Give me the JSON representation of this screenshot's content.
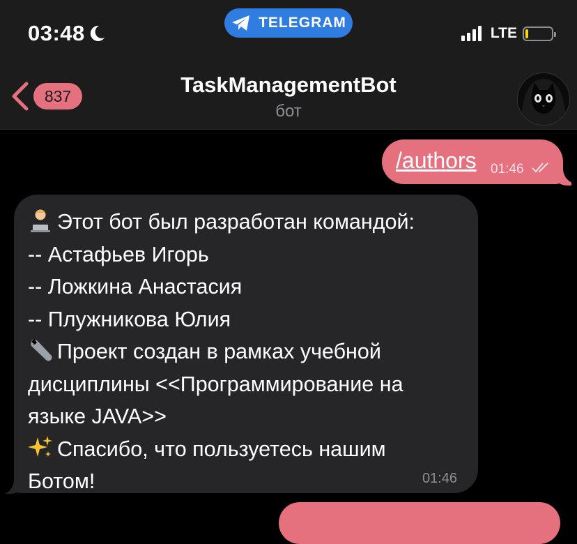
{
  "status_bar": {
    "time": "03:48",
    "return_pill_label": "TELEGRAM",
    "network": "LTE",
    "battery_level": 0.1
  },
  "header": {
    "unread_count": "837",
    "title": "TaskManagementBot",
    "subtitle": "бот"
  },
  "messages": {
    "outgoing": {
      "command": "/authors",
      "time": "01:46",
      "status": "read"
    },
    "incoming": {
      "lines": [
        "Этот бот был разработан командой:",
        "-- Астафьев Игорь",
        "-- Ложкина Анастасия",
        "-- Плужникова Юлия",
        "Проект создан в рамках учебной",
        "дисциплины <<Программирование на",
        "языке JAVA>>",
        "Спасибо, что пользуетесь нашим",
        "Ботом!"
      ],
      "time": "01:46"
    }
  },
  "colors": {
    "background": "#000000",
    "header_bg": "#1c1c1d",
    "accent": "#e5707e",
    "incoming_bubble": "#262628",
    "pill": "#2f7de1",
    "secondary_text": "#8e8e93"
  },
  "icons": {
    "moon": "moon-icon",
    "telegram": "telegram-plane-icon",
    "signal": "signal-bars-icon",
    "battery": "battery-icon",
    "back": "chevron-left-icon",
    "read": "double-check-icon",
    "technologist": "technologist-emoji",
    "wrench": "wrench-emoji",
    "sparkles": "sparkles-emoji"
  }
}
